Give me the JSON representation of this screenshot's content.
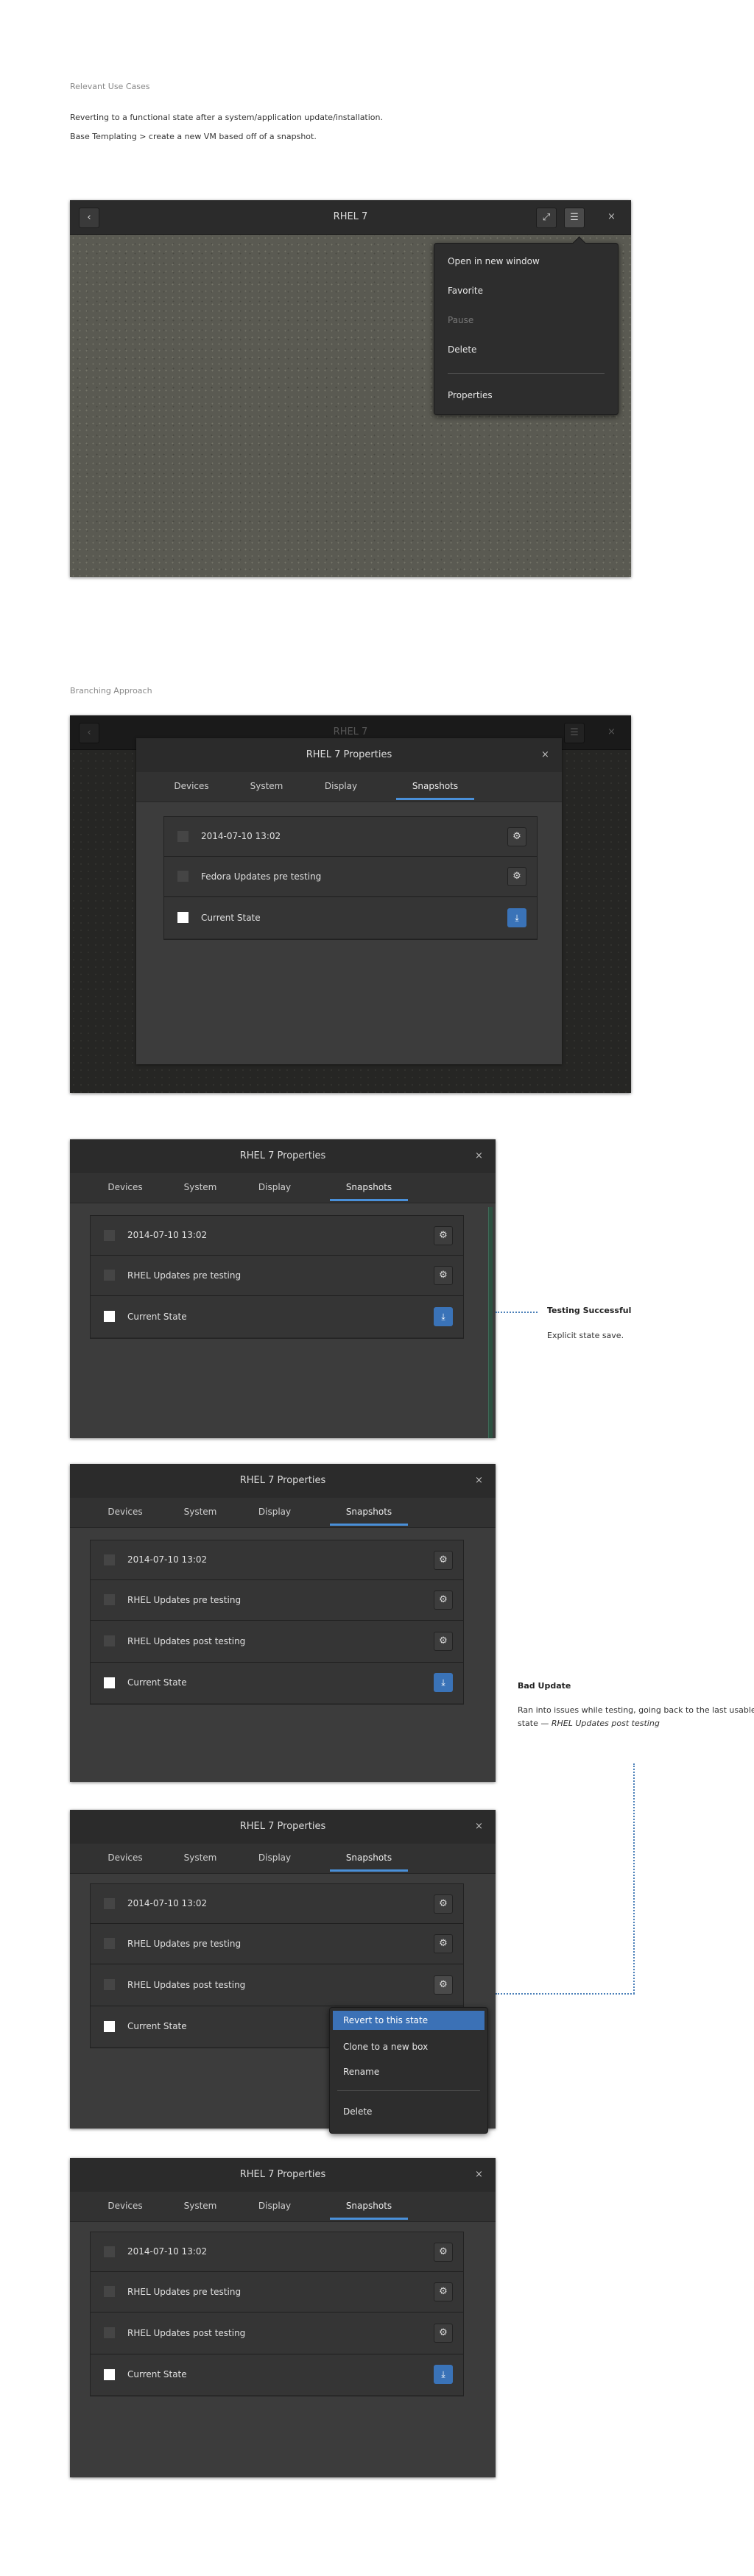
{
  "section1": {
    "title": "Relevant Use Cases",
    "lines": [
      "Reverting to a functional state after a system/application update/installation.",
      "Base Templating > create a new VM based off of a snapshot."
    ]
  },
  "window1": {
    "title": "RHEL 7",
    "back_icon": "chevron-left-icon",
    "fullscreen_icon": "fullscreen-icon",
    "menu_icon": "hamburger-icon",
    "close_icon": "close-icon",
    "back_glyph": "‹",
    "fullscreen_glyph": "⤢",
    "menu_glyph": "☰",
    "close_glyph": "×",
    "menu": {
      "open_new_window": "Open in new window",
      "favorite": "Favorite",
      "pause": "Pause",
      "delete": "Delete",
      "properties": "Properties"
    }
  },
  "section2": {
    "title": "Branching Approach"
  },
  "colors": {
    "accent": "#3a73b8",
    "tab_underline": "#4a90d9",
    "connector": "#4a7fb8"
  },
  "common": {
    "dialog_title": "RHEL 7 Properties",
    "close_glyph": "×",
    "gear_glyph": "⚙",
    "download_glyph": "⤓",
    "tabs": {
      "devices": "Devices",
      "system": "System",
      "display": "Display",
      "snapshots": "Snapshots"
    }
  },
  "dialog1": {
    "rows": [
      "2014-07-10 13:02",
      "Fedora Updates pre testing",
      "Current State"
    ]
  },
  "dialog2": {
    "rows": [
      "2014-07-10 13:02",
      "RHEL Updates pre testing",
      "Current State"
    ],
    "annotation": {
      "title": "Testing Successful",
      "text": "Explicit state save."
    }
  },
  "dialog3": {
    "rows": [
      "2014-07-10 13:02",
      "RHEL Updates pre testing",
      "RHEL Updates post testing",
      "Current State"
    ],
    "annotation": {
      "title": "Bad Update",
      "text_prefix": "Ran into issues while testing, going back to the last usable state — ",
      "text_em": "RHEL Updates post testing"
    }
  },
  "dialog4": {
    "rows": [
      "2014-07-10 13:02",
      "RHEL Updates pre testing",
      "RHEL Updates post testing",
      "Current State"
    ],
    "context_menu": {
      "revert": "Revert to this state",
      "clone": "Clone to a new box",
      "rename": "Rename",
      "delete": "Delete"
    }
  },
  "dialog5": {
    "rows": [
      "2014-07-10 13:02",
      "RHEL Updates pre testing",
      "RHEL Updates post testing",
      "Current State"
    ]
  }
}
